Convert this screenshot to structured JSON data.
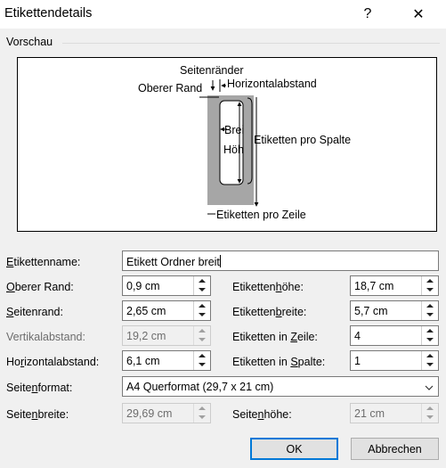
{
  "window": {
    "title": "Etikettendetails",
    "help_glyph": "?",
    "close_glyph": "✕"
  },
  "preview": {
    "group_label": "Vorschau",
    "seitenraender": "Seitenränder",
    "horizontalabstand": "Horizontalabstand",
    "oberer_rand": "Oberer Rand",
    "breite": "Brei",
    "hoehe": "Höh",
    "etiketten_pro_spalte": "Etiketten pro Spalte",
    "etiketten_pro_zeile": "Etiketten pro Zeile"
  },
  "form": {
    "etikettenname": {
      "label": "Etikettenname:",
      "value": "Etikett Ordner breit"
    },
    "oberer_rand": {
      "label": "Oberer Rand:",
      "value": "0,9 cm"
    },
    "seitenrand": {
      "label": "Seitenrand:",
      "value": "2,65 cm"
    },
    "vertikalabstand": {
      "label": "Vertikalabstand:",
      "value": "19,2 cm"
    },
    "horizontalabstand": {
      "label": "Horizontalabstand:",
      "value": "6,1 cm"
    },
    "etikettenhoehe": {
      "label": "Etikettenhöhe:",
      "value": "18,7 cm"
    },
    "etikettenbreite": {
      "label": "Etikettenbreite:",
      "value": "5,7 cm"
    },
    "etiketten_in_zeile": {
      "label": "Etiketten in Zeile:",
      "value": "4"
    },
    "etiketten_in_spalte": {
      "label": "Etiketten in Spalte:",
      "value": "1"
    },
    "seitenformat": {
      "label": "Seitenformat:",
      "value": "A4 Querformat (29,7 x 21 cm)"
    },
    "seitenbreite": {
      "label": "Seitenbreite:",
      "value": "29,69 cm"
    },
    "seitenhoehe": {
      "label": "Seitenhöhe:",
      "value": "21 cm"
    }
  },
  "buttons": {
    "ok": "OK",
    "cancel": "Abbrechen"
  },
  "icons": {
    "help": "help-icon",
    "close": "close-icon",
    "spin_up": "spin-up-icon",
    "spin_down": "spin-down-icon",
    "dropdown": "chevron-down-icon"
  }
}
